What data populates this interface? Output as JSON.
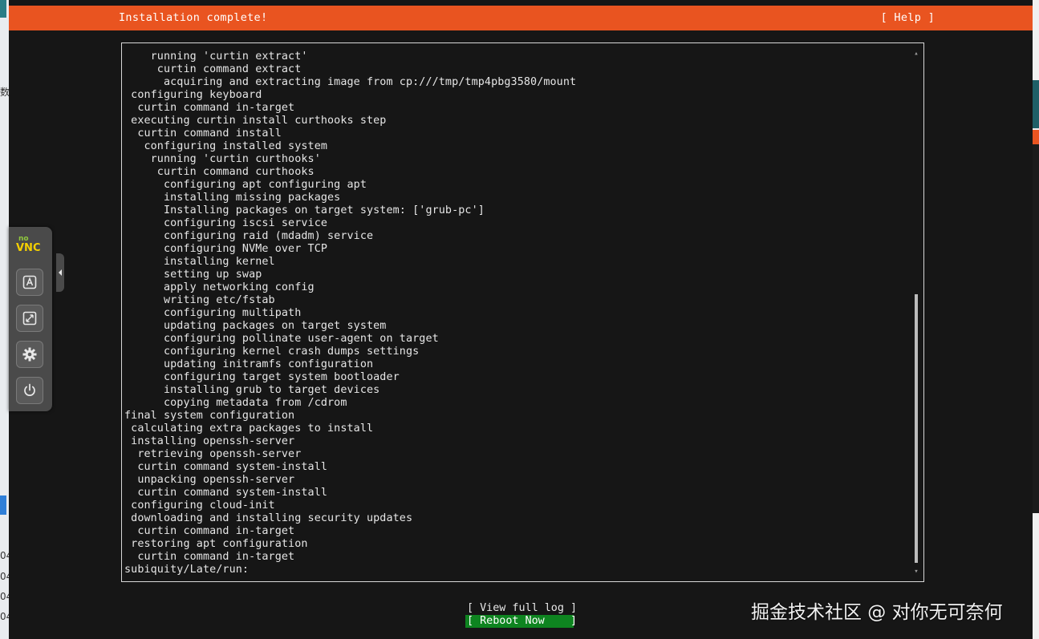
{
  "header": {
    "title": "Installation complete!",
    "help": "[ Help ]"
  },
  "log": {
    "lines": [
      "    running 'curtin extract'",
      "     curtin command extract",
      "      acquiring and extracting image from cp:///tmp/tmp4pbg3580/mount",
      " configuring keyboard",
      "  curtin command in-target",
      " executing curtin install curthooks step",
      "  curtin command install",
      "   configuring installed system",
      "    running 'curtin curthooks'",
      "     curtin command curthooks",
      "      configuring apt configuring apt",
      "      installing missing packages",
      "      Installing packages on target system: ['grub-pc']",
      "      configuring iscsi service",
      "      configuring raid (mdadm) service",
      "      configuring NVMe over TCP",
      "      installing kernel",
      "      setting up swap",
      "      apply networking config",
      "      writing etc/fstab",
      "      configuring multipath",
      "      updating packages on target system",
      "      configuring pollinate user-agent on target",
      "      configuring kernel crash dumps settings",
      "      updating initramfs configuration",
      "      configuring target system bootloader",
      "      installing grub to target devices",
      "      copying metadata from /cdrom",
      "final system configuration",
      " calculating extra packages to install",
      " installing openssh-server",
      "  retrieving openssh-server",
      "  curtin command system-install",
      "  unpacking openssh-server",
      "  curtin command system-install",
      " configuring cloud-init",
      " downloading and installing security updates",
      "  curtin command in-target",
      " restoring apt configuration",
      "  curtin command in-target",
      "subiquity/Late/run:"
    ],
    "scroll_up": "▴",
    "scroll_down": "▾"
  },
  "buttons": {
    "view_log": "[ View full log ]",
    "reboot": "[ Reboot Now    ]"
  },
  "novnc": {
    "logo_top": "no",
    "logo_bottom": "VNC",
    "icons": [
      "keyboard-icon",
      "fullscreen-icon",
      "settings-icon",
      "power-icon"
    ]
  },
  "host_left_fragments": [
    "数",
    "04",
    "04",
    "04",
    "04"
  ],
  "watermark": "掘金技术社区 @ 对你无可奈何",
  "colors": {
    "ubuntu_orange": "#e95420",
    "selected_button": "#0e8420",
    "terminal_bg": "#161616",
    "novnc_bg": "#4a4a4a",
    "novnc_logo_green": "#8fc73e",
    "novnc_logo_yellow": "#f5d000"
  }
}
